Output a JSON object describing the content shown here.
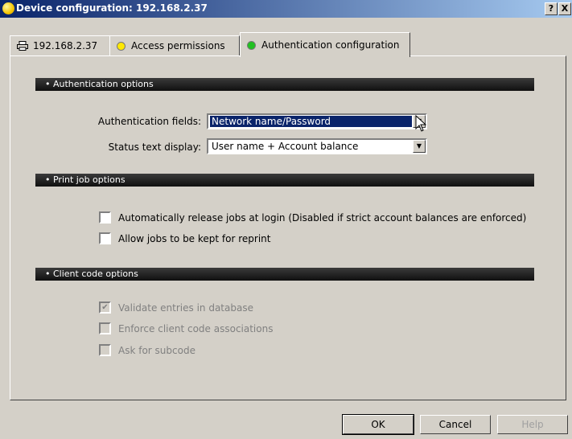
{
  "window": {
    "title": "Device configuration: 192.168.2.37",
    "help_btn": "?",
    "close_btn": "X"
  },
  "tabs": [
    {
      "label": "192.168.2.37",
      "icon": "printer-icon"
    },
    {
      "label": "Access permissions",
      "icon": "yellow-dot-icon",
      "color": "#ffe800"
    },
    {
      "label": "Authentication configuration",
      "icon": "green-dot-icon",
      "color": "#21c021",
      "active": true
    }
  ],
  "auth": {
    "header": "• Authentication options",
    "fields_label": "Authentication fields:",
    "fields_value": "Network name/Password",
    "status_label": "Status text display:",
    "status_value": "User name + Account balance"
  },
  "print_job": {
    "header": "• Print job options",
    "auto_release": "Automatically release jobs at login (Disabled if strict account balances are enforced)",
    "auto_release_checked": false,
    "keep_reprint": "Allow jobs to be kept for reprint",
    "keep_reprint_checked": false
  },
  "client_code": {
    "header": "• Client code options",
    "validate": "Validate entries in database",
    "validate_checked": true,
    "enforce": "Enforce client code associations",
    "enforce_checked": false,
    "subcode": "Ask for subcode",
    "subcode_checked": false
  },
  "buttons": {
    "ok": "OK",
    "cancel": "Cancel",
    "help": "Help"
  },
  "colors": {
    "title_bar": "#0a246a",
    "selection": "#0a246a",
    "section_bar": "#1a1a1a"
  }
}
